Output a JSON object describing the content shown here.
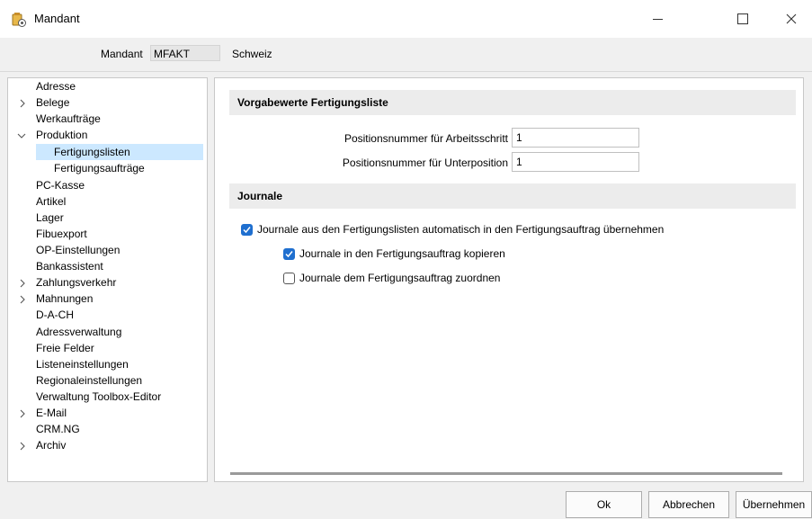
{
  "window": {
    "title": "Mandant"
  },
  "mandant_bar": {
    "label": "Mandant",
    "code": "MFAKT",
    "name": "Schweiz"
  },
  "tree": {
    "items": [
      {
        "label": "Adresse",
        "arrow": "none"
      },
      {
        "label": "Belege",
        "arrow": "right"
      },
      {
        "label": "Werkaufträge",
        "arrow": "none"
      },
      {
        "label": "Produktion",
        "arrow": "down"
      },
      {
        "label": "Fertigungslisten",
        "arrow": "none",
        "selected": true
      },
      {
        "label": "Fertigungsaufträge",
        "arrow": "none"
      },
      {
        "label": "PC-Kasse",
        "arrow": "none"
      },
      {
        "label": "Artikel",
        "arrow": "none"
      },
      {
        "label": "Lager",
        "arrow": "none"
      },
      {
        "label": "Fibuexport",
        "arrow": "none"
      },
      {
        "label": "OP-Einstellungen",
        "arrow": "none"
      },
      {
        "label": "Bankassistent",
        "arrow": "none"
      },
      {
        "label": "Zahlungsverkehr",
        "arrow": "right"
      },
      {
        "label": "Mahnungen",
        "arrow": "right"
      },
      {
        "label": "D-A-CH",
        "arrow": "none"
      },
      {
        "label": "Adressverwaltung",
        "arrow": "none"
      },
      {
        "label": "Freie Felder",
        "arrow": "none"
      },
      {
        "label": "Listeneinstellungen",
        "arrow": "none"
      },
      {
        "label": "Regionaleinstellungen",
        "arrow": "none"
      },
      {
        "label": "Verwaltung Toolbox-Editor",
        "arrow": "none"
      },
      {
        "label": "E-Mail",
        "arrow": "right"
      },
      {
        "label": "CRM.NG",
        "arrow": "none"
      },
      {
        "label": "Archiv",
        "arrow": "right"
      }
    ]
  },
  "panel": {
    "section1": {
      "title": "Vorgabewerte Fertigungsliste",
      "fields": [
        {
          "label": "Positionsnummer für Arbeitsschritt",
          "value": "1"
        },
        {
          "label": "Positionsnummer für Unterposition",
          "value": "1"
        }
      ]
    },
    "section2": {
      "title": "Journale",
      "checkboxes": [
        {
          "label": "Journale aus den Fertigungslisten automatisch in den Fertigungsauftrag übernehmen",
          "checked": true
        },
        {
          "label": "Journale in den Fertigungsauftrag kopieren",
          "checked": true
        },
        {
          "label": "Journale dem Fertigungsauftrag zuordnen",
          "checked": false
        }
      ]
    }
  },
  "buttons": {
    "ok": "Ok",
    "cancel": "Abbrechen",
    "apply": "Übernehmen"
  },
  "colors": {
    "accent": "#1f6fcf",
    "selection": "#cce8ff"
  }
}
